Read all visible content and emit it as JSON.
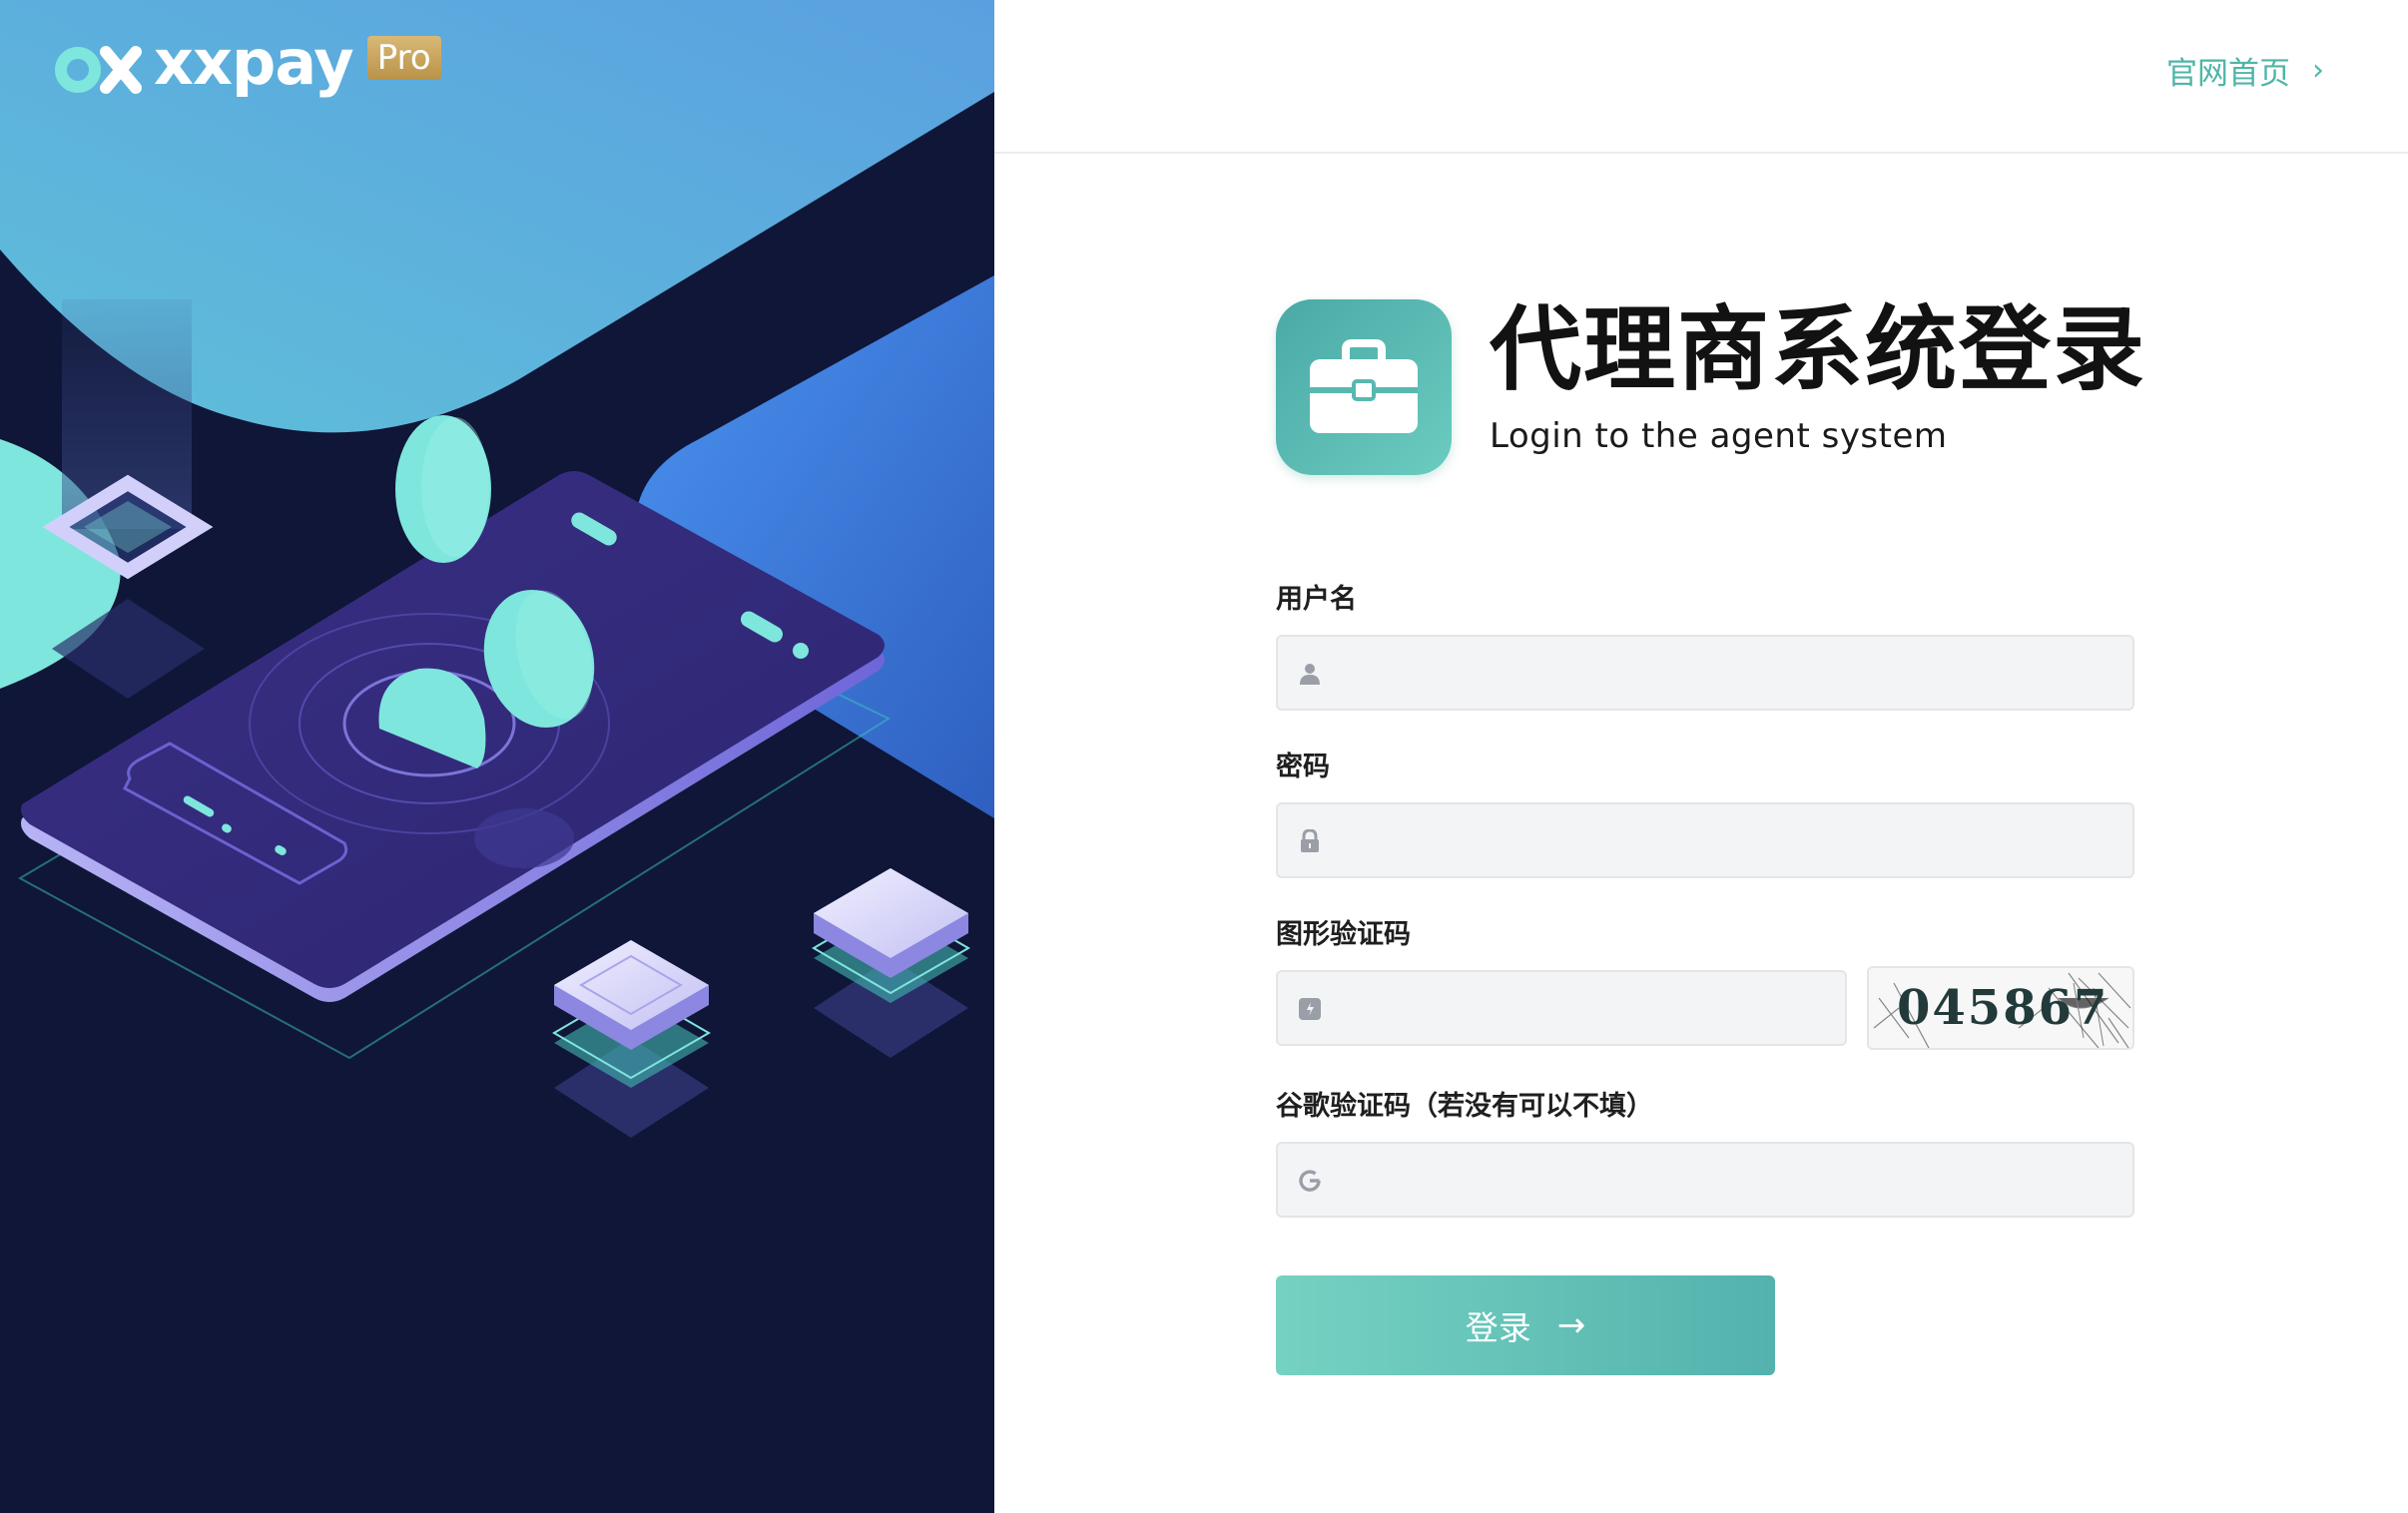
{
  "brand": {
    "logo_text": "xxpay",
    "logo_badge": "Pro"
  },
  "header": {
    "home_link": "官网首页",
    "home_chevron": "›"
  },
  "heading": {
    "title": "代理商系统登录",
    "subtitle": "Login to the agent system",
    "icon": "briefcase-icon"
  },
  "form": {
    "username": {
      "label": "用户名",
      "value": "",
      "icon": "user-icon"
    },
    "password": {
      "label": "密码",
      "value": "",
      "icon": "lock-icon"
    },
    "captcha": {
      "label": "图形验证码",
      "value": "",
      "icon": "captcha-icon",
      "image_text": "045867"
    },
    "google_code": {
      "label": "谷歌验证码（若没有可以不填）",
      "value": "",
      "icon": "google-icon"
    },
    "submit": {
      "label": "登录",
      "arrow": "→"
    }
  },
  "colors": {
    "accent": "#53b2ad",
    "accent_light": "#75d2c2",
    "illustration_bg": "#0f1637",
    "sky_blue": "#57a8e0",
    "mint": "#7ee6dc",
    "phone_purple": "#322b7a"
  }
}
